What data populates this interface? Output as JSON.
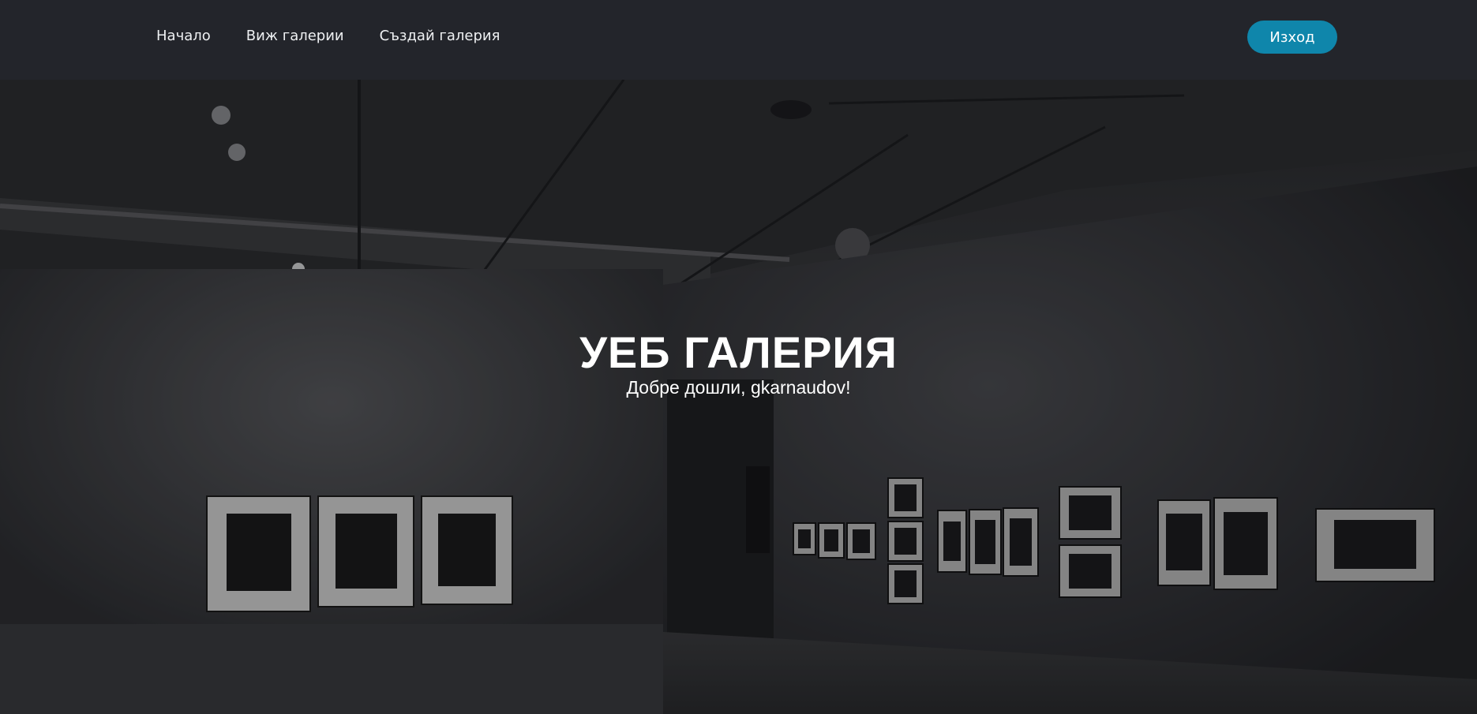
{
  "nav": {
    "links": [
      {
        "label": "Начало"
      },
      {
        "label": "Виж галерии"
      },
      {
        "label": "Създай галерия"
      }
    ],
    "logout_label": "Изход"
  },
  "hero": {
    "title": "УЕБ ГАЛЕРИЯ",
    "subtitle": "Добре дошли, gkarnaudov!",
    "background_image": "dark art gallery interior with framed black-and-white photographs"
  },
  "colors": {
    "navbar_bg": "#23252b",
    "accent": "#0f86ab",
    "text": "#ffffff"
  }
}
